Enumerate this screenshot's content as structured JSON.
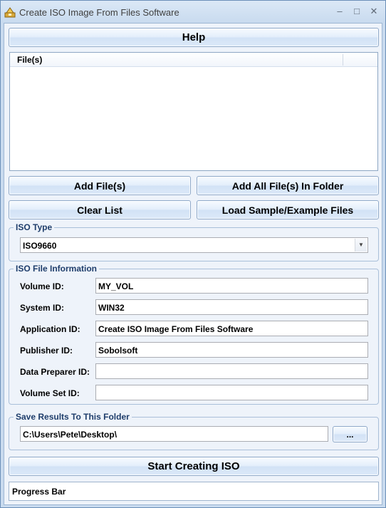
{
  "window": {
    "title": "Create ISO Image From Files Software",
    "minimize_glyph": "–",
    "maximize_glyph": "□",
    "close_glyph": "✕"
  },
  "buttons": {
    "help": "Help",
    "add_files": "Add File(s)",
    "add_all_folder": "Add All File(s) In Folder",
    "clear_list": "Clear List",
    "load_sample": "Load Sample/Example Files",
    "browse": "...",
    "start": "Start Creating ISO"
  },
  "file_list": {
    "column_header": "File(s)",
    "rows": []
  },
  "iso_type": {
    "group_label": "ISO Type",
    "selected": "ISO9660"
  },
  "iso_info": {
    "group_label": "ISO File Information",
    "fields": [
      {
        "label": "Volume ID:",
        "value": "MY_VOL"
      },
      {
        "label": "System ID:",
        "value": "WIN32"
      },
      {
        "label": "Application ID:",
        "value": "Create ISO Image From Files Software"
      },
      {
        "label": "Publisher ID:",
        "value": "Sobolsoft"
      },
      {
        "label": "Data Preparer ID:",
        "value": ""
      },
      {
        "label": "Volume Set ID:",
        "value": ""
      }
    ]
  },
  "save": {
    "group_label": "Save Results To This Folder",
    "path": "C:\\Users\\Pete\\Desktop\\"
  },
  "progress": {
    "label": "Progress Bar"
  },
  "colors": {
    "group_label_text": "#1e3d6b",
    "window_background": "#eef3fa"
  }
}
